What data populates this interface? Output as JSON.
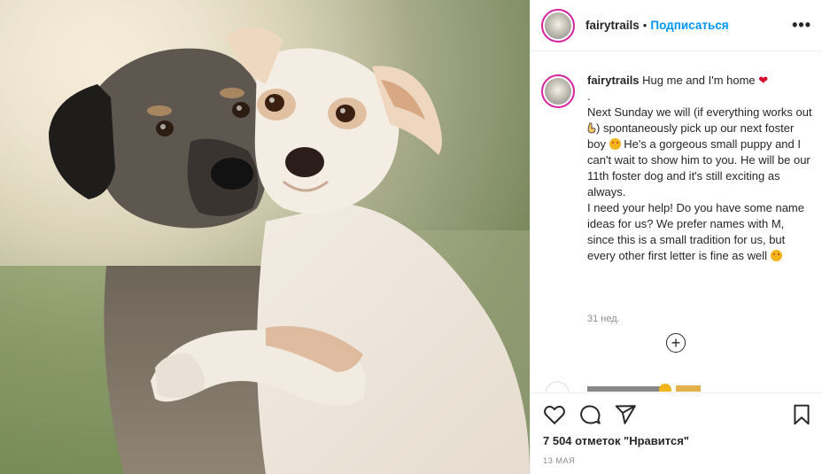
{
  "post": {
    "username": "fairytrails",
    "separator": "•",
    "follow_label": "Подписаться",
    "more_label": "•••"
  },
  "caption": {
    "username": "fairytrails",
    "line1": "Hug me and I'm home",
    "heart": "❤",
    "dot": ".",
    "p1_a": "Next Sunday we will (if everything works out",
    "p1_b": ") spontaneously pick up our next foster boy",
    "p1_c": "He's a gorgeous small puppy and I can't wait to show him to you. He will be our 11th foster dog and it's still exciting as always.",
    "p2": "I need your help! Do you have some name ideas for us? We prefer names with M, since this is a small tradition for us, but every other first letter is fine as well",
    "time_ago": "31 нед."
  },
  "comments": {
    "load_more_label": "+"
  },
  "actions": {
    "likes": "7 504 отметок \"Нравится\"",
    "date": "13 МАЯ"
  },
  "icons": [
    "heart-icon",
    "comment-icon",
    "share-icon",
    "bookmark-icon",
    "more-icon",
    "load-more-icon"
  ],
  "colors": {
    "link": "#0095f6",
    "text": "#262626",
    "muted": "#8e8e8e",
    "heart": "#d8002a",
    "story_ring": "#d6249f"
  }
}
